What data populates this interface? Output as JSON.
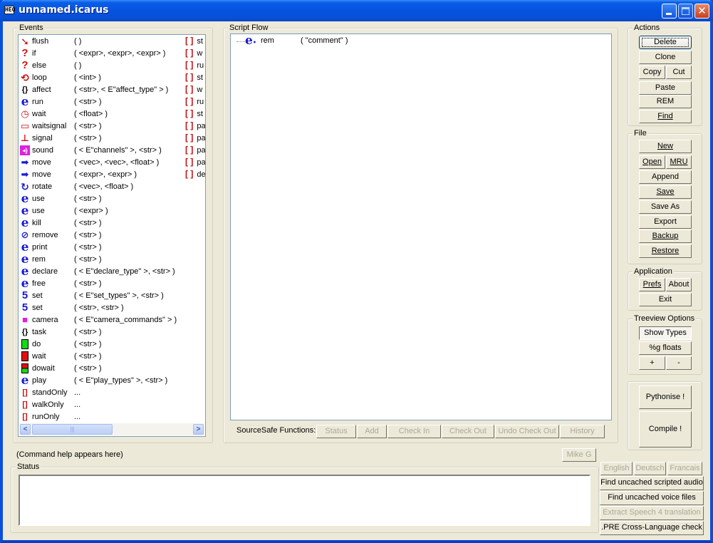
{
  "window": {
    "title": "unnamed.icarus",
    "app_icon": "icarus-app-icon",
    "controls": [
      "minimize",
      "maximize",
      "close"
    ]
  },
  "events": {
    "label": "Events",
    "items": [
      {
        "icon": "flush-arrow-icon",
        "name": "flush",
        "args": "(   )"
      },
      {
        "icon": "question-icon",
        "name": "if",
        "args": "(  <expr>, <expr>, <expr>  )"
      },
      {
        "icon": "question-icon",
        "name": "else",
        "args": "(   )"
      },
      {
        "icon": "loop-icon",
        "name": "loop",
        "args": "(  <int>  )"
      },
      {
        "icon": "braces-icon",
        "name": "affect",
        "args": "(  <str>, < E\"affect_type\" >  )"
      },
      {
        "icon": "e-icon",
        "name": "run",
        "args": "(  <str>  )"
      },
      {
        "icon": "clock-icon",
        "name": "wait",
        "args": "(  <float>  )"
      },
      {
        "icon": "waitsignal-icon",
        "name": "waitsignal",
        "args": "(  <str>  )"
      },
      {
        "icon": "signal-icon",
        "name": "signal",
        "args": "(  <str>  )"
      },
      {
        "icon": "sound-icon",
        "name": "sound",
        "args": "(  < E\"channels\" >, <str>  )"
      },
      {
        "icon": "arrow-right-icon",
        "name": "move",
        "args": "(  <vec>, <vec>, <float>  )"
      },
      {
        "icon": "arrow-right-icon",
        "name": "move",
        "args": "(  <expr>, <expr>  )"
      },
      {
        "icon": "rotate-icon",
        "name": "rotate",
        "args": "(  <vec>, <float>  )"
      },
      {
        "icon": "e-icon",
        "name": "use",
        "args": "(  <str>  )"
      },
      {
        "icon": "e-icon",
        "name": "use",
        "args": "(  <expr>  )"
      },
      {
        "icon": "e-icon",
        "name": "kill",
        "args": "(  <str>  )"
      },
      {
        "icon": "remove-icon",
        "name": "remove",
        "args": "(  <str>  )"
      },
      {
        "icon": "e-icon",
        "name": "print",
        "args": "(  <str>  )"
      },
      {
        "icon": "e-icon",
        "name": "rem",
        "args": "(  <str>  )"
      },
      {
        "icon": "e-icon",
        "name": "declare",
        "args": "(  < E\"declare_type\" >, <str>  )"
      },
      {
        "icon": "e-icon",
        "name": "free",
        "args": "(  <str>  )"
      },
      {
        "icon": "set-icon",
        "name": "set",
        "args": "(  < E\"set_types\" >, <str>  )"
      },
      {
        "icon": "set-icon",
        "name": "set",
        "args": "(  <str>, <str>  )"
      },
      {
        "icon": "camera-icon",
        "name": "camera",
        "args": "(  < E\"camera_commands\" >  )"
      },
      {
        "icon": "braces-icon",
        "name": "task",
        "args": "(  <str>  )"
      },
      {
        "icon": "green-block-icon",
        "name": "do",
        "args": "(  <str>  )"
      },
      {
        "icon": "red-block-icon",
        "name": "wait",
        "args": "(  <str>  )"
      },
      {
        "icon": "dowait-icon",
        "name": "dowait",
        "args": "(  <str>  )"
      },
      {
        "icon": "e-icon",
        "name": "play",
        "args": "(  < E\"play_types\" >, <str>  )"
      },
      {
        "icon": "bracket-icon",
        "name": "standOnly",
        "args": "..."
      },
      {
        "icon": "bracket-icon",
        "name": "walkOnly",
        "args": "..."
      },
      {
        "icon": "bracket-icon",
        "name": "runOnly",
        "args": "..."
      }
    ],
    "right_column": [
      "st",
      "w",
      "ru",
      "st",
      "w",
      "ru",
      "st",
      "pa",
      "pa",
      "pa",
      "pa",
      "de"
    ]
  },
  "script_flow": {
    "label": "Script Flow",
    "nodes": [
      {
        "icon": "e-icon",
        "name": "rem",
        "args": "(  \"comment\"  )"
      }
    ],
    "sourcesafe_label": "SourceSafe Functions:",
    "sourcesafe_buttons": [
      "Status",
      "Add",
      "Check In",
      "Check Out",
      "Undo Check Out",
      "History"
    ]
  },
  "actions": {
    "label": "Actions",
    "delete": "Delete",
    "clone": "Clone",
    "copy": "Copy",
    "cut": "Cut",
    "paste": "Paste",
    "rem": "REM",
    "find": "Find"
  },
  "file": {
    "label": "File",
    "new": "New",
    "open": "Open",
    "mru": "MRU",
    "append": "Append",
    "save": "Save",
    "save_as": "Save As",
    "export": "Export",
    "backup": "Backup",
    "restore": "Restore"
  },
  "application": {
    "label": "Application",
    "prefs": "Prefs",
    "about": "About",
    "exit": "Exit"
  },
  "treeview": {
    "label": "Treeview Options",
    "show_types": "Show Types",
    "g_floats": "%g floats",
    "plus": "+",
    "minus": "-"
  },
  "compile": {
    "pythonise": "Pythonise !",
    "compile": "Compile !"
  },
  "help_text": "(Command help appears here)",
  "user_button": "Mike G",
  "status": {
    "label": "Status",
    "value": ""
  },
  "languages": [
    "English",
    "Deutsch",
    "Francais"
  ],
  "tools": {
    "find_audio": "Find uncached scripted audio",
    "find_voice": "Find uncached voice files",
    "extract_speech": "Extract Speech 4 translation",
    "pre_check": ".PRE Cross-Language check"
  },
  "colors": {
    "title_blue": "#0553e0",
    "face": "#ece9d8",
    "bracket_red": "#c41010",
    "e_blue": "#1a1ad0",
    "disabled_text": "#aca899"
  }
}
